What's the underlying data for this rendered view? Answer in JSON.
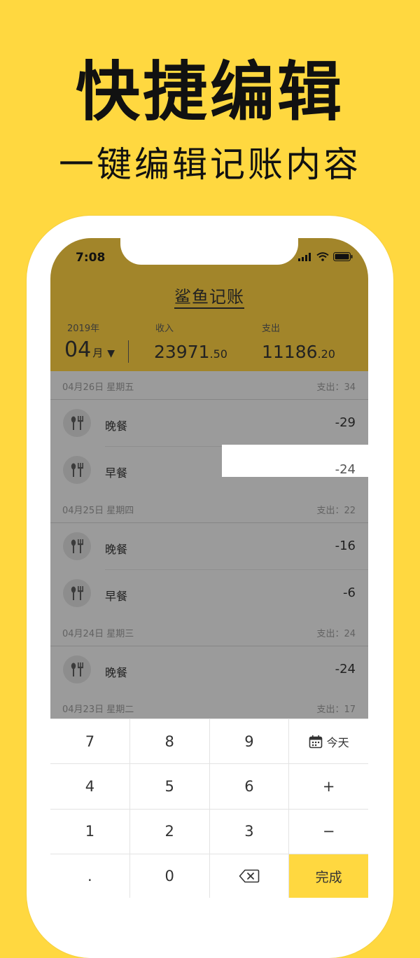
{
  "promo": {
    "title": "快捷编辑",
    "subtitle": "一键编辑记账内容"
  },
  "status_bar": {
    "time": "7:08",
    "icons": [
      "signal-icon",
      "wifi-icon",
      "battery-icon"
    ]
  },
  "app": {
    "title": "鲨鱼记账"
  },
  "summary": {
    "year": "2019年",
    "month": "04",
    "month_unit": "月",
    "income_label": "收入",
    "income_int": "23971",
    "income_dec": ".50",
    "expense_label": "支出",
    "expense_int": "11186",
    "expense_dec": ".20"
  },
  "days": [
    {
      "date": "04月26日  星期五",
      "total": "支出：34",
      "entries": [
        {
          "label": "晚餐",
          "amount": "-29",
          "icon": "fork-spoon-icon"
        },
        {
          "label": "早餐",
          "amount": "-24",
          "icon": "fork-spoon-icon"
        }
      ]
    },
    {
      "date": "04月25日  星期四",
      "total": "支出：22",
      "entries": [
        {
          "label": "晚餐",
          "amount": "-16",
          "icon": "fork-spoon-icon"
        },
        {
          "label": "早餐",
          "amount": "-6",
          "icon": "fork-spoon-icon"
        }
      ]
    },
    {
      "date": "04月24日  星期三",
      "total": "支出：24",
      "entries": [
        {
          "label": "晚餐",
          "amount": "-24",
          "icon": "fork-spoon-icon"
        }
      ]
    },
    {
      "date": "04月23日  星期二",
      "total": "支出：17",
      "entries": []
    }
  ],
  "keypad": {
    "k7": "7",
    "k8": "8",
    "k9": "9",
    "today": "今天",
    "k4": "4",
    "k5": "5",
    "k6": "6",
    "plus": "+",
    "k1": "1",
    "k2": "2",
    "k3": "3",
    "minus": "−",
    "dot": ".",
    "k0": "0",
    "done": "完成"
  },
  "colors": {
    "background": "#FFD840",
    "header": "#A2852A",
    "accent": "#FFD840",
    "list_overlay": "#9B9B9B"
  }
}
